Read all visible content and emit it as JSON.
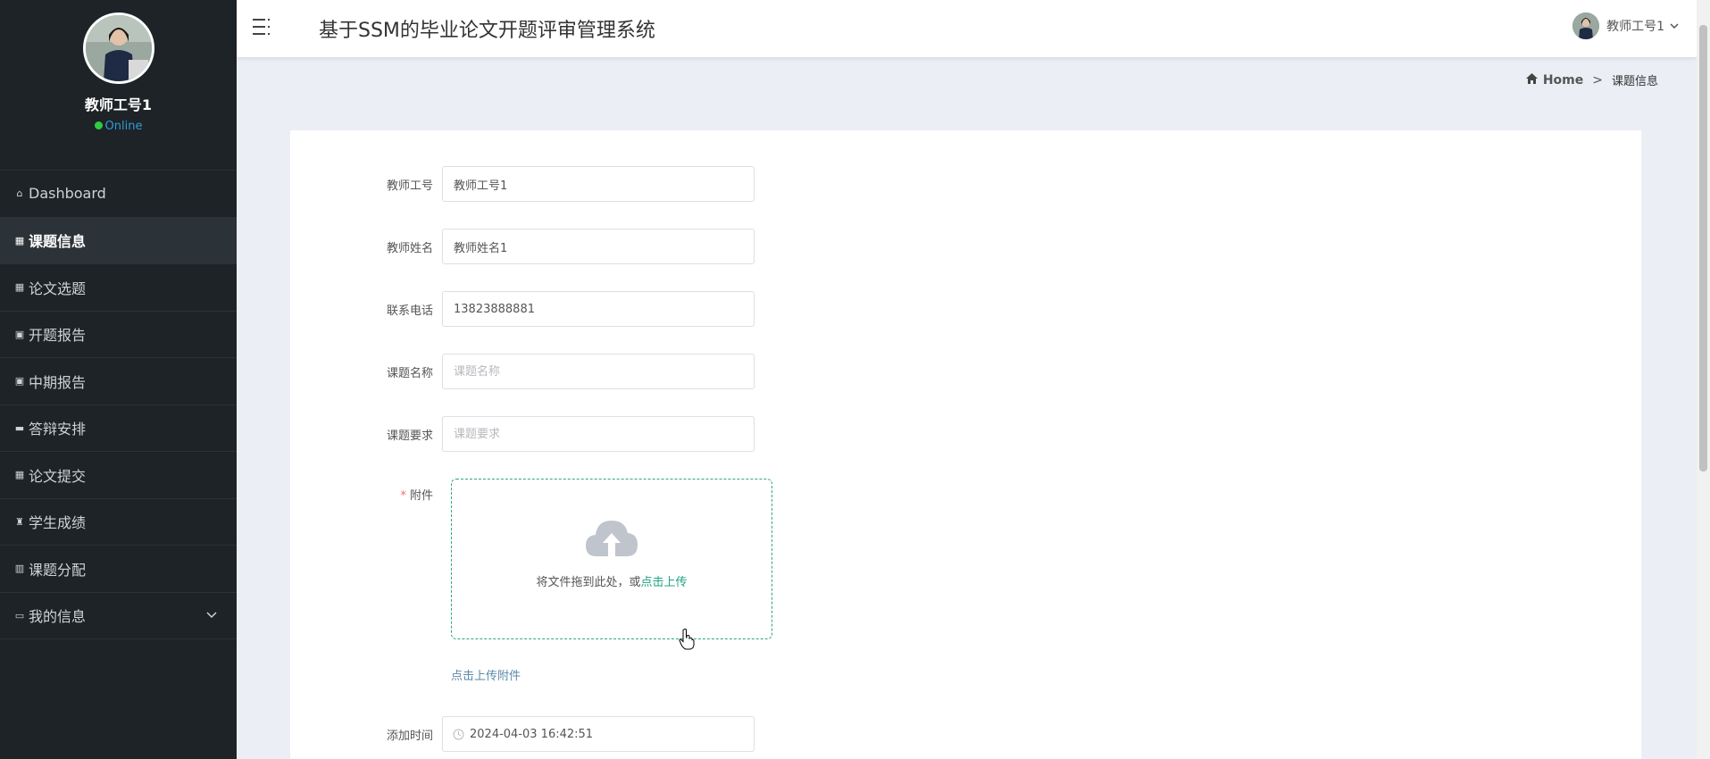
{
  "sidebar": {
    "user_name": "教师工号1",
    "status": "Online",
    "items": [
      {
        "label": "Dashboard",
        "icon": "home-outline-icon"
      },
      {
        "label": "课题信息",
        "icon": "grid-icon",
        "active": true
      },
      {
        "label": "论文选题",
        "icon": "grid-icon"
      },
      {
        "label": "开题报告",
        "icon": "clipboard-icon"
      },
      {
        "label": "中期报告",
        "icon": "clipboard-icon"
      },
      {
        "label": "答辩安排",
        "icon": "ticket-icon"
      },
      {
        "label": "论文提交",
        "icon": "grid-icon"
      },
      {
        "label": "学生成绩",
        "icon": "trophy-icon"
      },
      {
        "label": "课题分配",
        "icon": "bar-chart-icon"
      },
      {
        "label": "我的信息",
        "icon": "credit-card-icon",
        "expandable": true
      }
    ]
  },
  "header": {
    "title": "基于SSM的毕业论文开题评审管理系统",
    "user": "教师工号1"
  },
  "breadcrumb": {
    "home": "Home",
    "separator": ">",
    "current": "课题信息"
  },
  "form": {
    "teacher_id": {
      "label": "教师工号",
      "value": "教师工号1"
    },
    "teacher_name": {
      "label": "教师姓名",
      "value": "教师姓名1"
    },
    "phone": {
      "label": "联系电话",
      "value": "13823888881"
    },
    "topic_name": {
      "label": "课题名称",
      "placeholder": "课题名称"
    },
    "topic_req": {
      "label": "课题要求",
      "placeholder": "课题要求"
    },
    "attachment": {
      "label": "附件",
      "required_mark": "*",
      "drop_text": "将文件拖到此处，或",
      "click_text": "点击上传",
      "tip": "点击上传附件"
    },
    "add_time": {
      "label": "添加时间",
      "value": "2024-04-03 16:42:51"
    }
  },
  "colors": {
    "sidebar_bg": "#1d2327",
    "accent": "#1fa383",
    "page_bg": "#ebeef5"
  }
}
